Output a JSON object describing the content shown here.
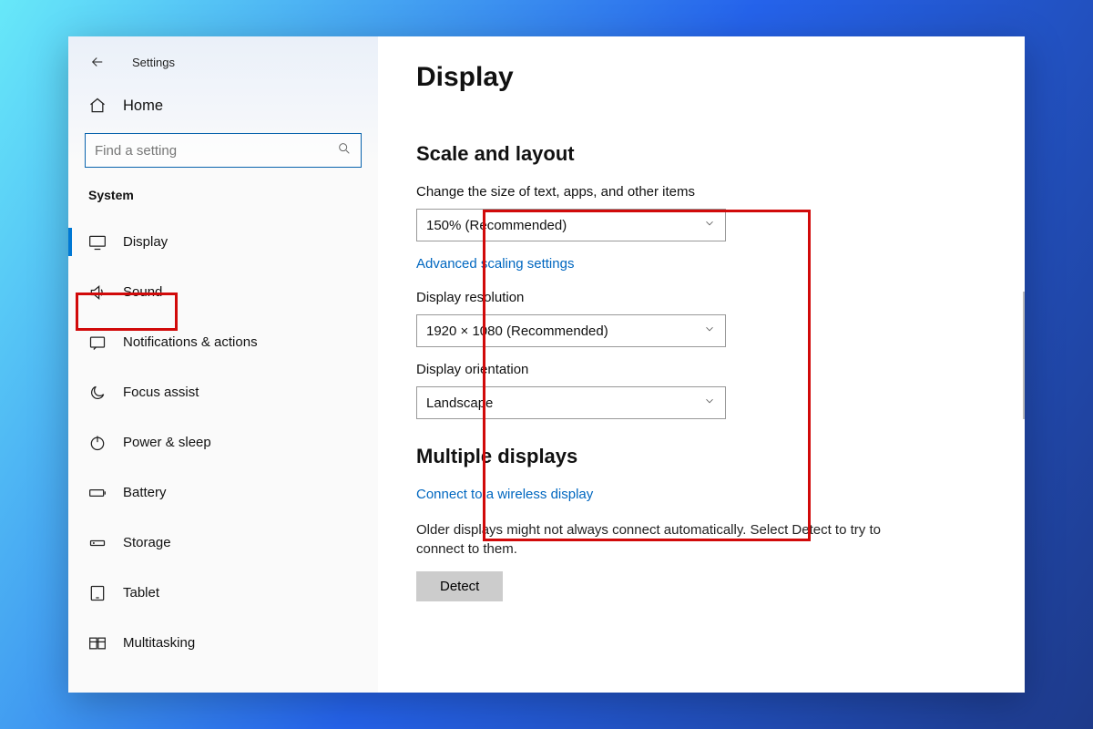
{
  "header": {
    "app_title": "Settings"
  },
  "sidebar": {
    "home_label": "Home",
    "search_placeholder": "Find a setting",
    "section_label": "System",
    "items": [
      {
        "label": "Display",
        "active": true
      },
      {
        "label": "Sound"
      },
      {
        "label": "Notifications & actions"
      },
      {
        "label": "Focus assist"
      },
      {
        "label": "Power & sleep"
      },
      {
        "label": "Battery"
      },
      {
        "label": "Storage"
      },
      {
        "label": "Tablet"
      },
      {
        "label": "Multitasking"
      }
    ]
  },
  "main": {
    "page_title": "Display",
    "scale_section": "Scale and layout",
    "scale_field_label": "Change the size of text, apps, and other items",
    "scale_value": "150% (Recommended)",
    "advanced_link": "Advanced scaling settings",
    "resolution_label": "Display resolution",
    "resolution_value": "1920 × 1080 (Recommended)",
    "orientation_label": "Display orientation",
    "orientation_value": "Landscape",
    "multiple_section": "Multiple displays",
    "wireless_link": "Connect to a wireless display",
    "detect_desc": "Older displays might not always connect automatically. Select Detect to try to connect to them.",
    "detect_btn": "Detect"
  }
}
